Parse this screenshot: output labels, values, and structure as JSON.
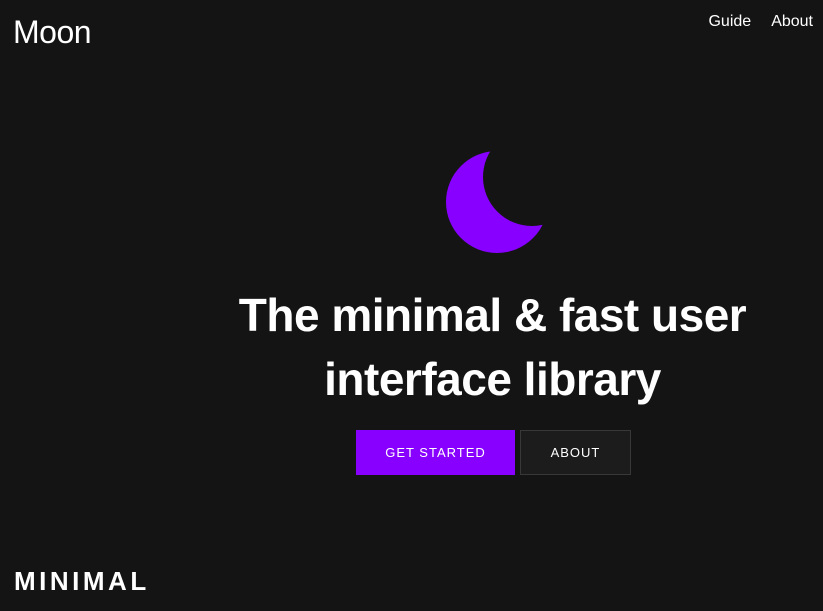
{
  "header": {
    "brand": "Moon",
    "nav": {
      "guide": "Guide",
      "about": "About"
    }
  },
  "hero": {
    "logo_icon": "moon-icon",
    "headline_line1": "The minimal & fast user",
    "headline_line2": "interface library",
    "primary_button": "GET STARTED",
    "secondary_button": "ABOUT"
  },
  "section": {
    "label": "MINIMAL"
  },
  "colors": {
    "background": "#141414",
    "accent": "#8800ff",
    "text": "#ffffff",
    "secondary_button_bg": "#1c1c1c",
    "secondary_button_border": "#383838"
  }
}
